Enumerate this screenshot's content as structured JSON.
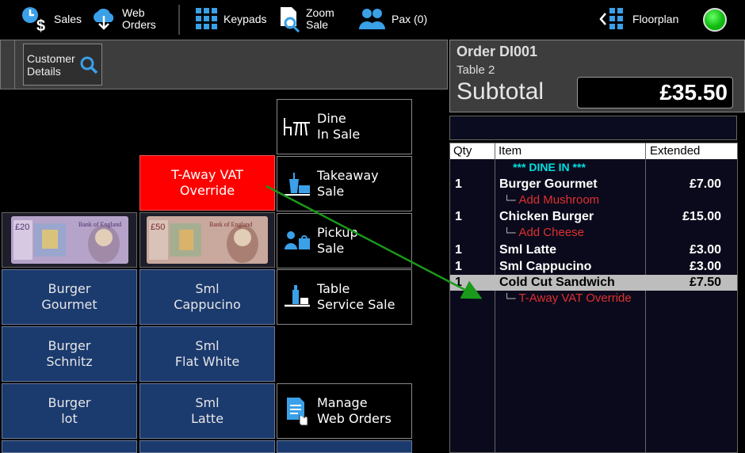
{
  "toolbar": {
    "sales_label": "Sales",
    "web_orders_label": "Web\nOrders",
    "keypads_label": "Keypads",
    "zoom_sale_label": "Zoom\nSale",
    "pax_label": "Pax (0)",
    "floorplan_label": "Floorplan",
    "status_color": "#11bb11"
  },
  "customer": {
    "details_label": "Customer\nDetails"
  },
  "tiles": {
    "override": "T-Away VAT\nOverride",
    "grid": [
      "Burger\nGourmet",
      "Sml\nCappucino",
      "Burger\nSchnitz",
      "Sml\nFlat White",
      "Burger\nlot",
      "Sml\nLatte"
    ],
    "notes": [
      "£20 note",
      "£50 note"
    ]
  },
  "sale_types": [
    {
      "label": "Dine\nIn Sale",
      "icon": "dine-in-icon"
    },
    {
      "label": "Takeaway\nSale",
      "icon": "takeaway-icon"
    },
    {
      "label": "Pickup\nSale",
      "icon": "pickup-icon"
    },
    {
      "label": "Table\nService Sale",
      "icon": "table-service-icon"
    },
    {
      "label": "Manage\nWeb Orders",
      "icon": "manage-web-orders-icon"
    }
  ],
  "order": {
    "title": "Order DI001",
    "table": "Table 2",
    "subtotal_label": "Subtotal",
    "subtotal_value": "£35.50",
    "columns": [
      "Qty",
      "Item",
      "Extended"
    ],
    "section_header": "*** DINE IN ***",
    "lines": [
      {
        "qty": "1",
        "item": "Burger Gourmet",
        "price": "£7.00",
        "modifier": "Add Mushroom"
      },
      {
        "qty": "1",
        "item": "Chicken Burger",
        "price": "£15.00",
        "modifier": "Add Cheese"
      },
      {
        "qty": "1",
        "item": "Sml Latte",
        "price": "£3.00"
      },
      {
        "qty": "1",
        "item": "Sml Cappucino",
        "price": "£3.00"
      },
      {
        "qty": "1",
        "item": "Cold Cut Sandwich",
        "price": "£7.50",
        "modifier": "T-Away VAT Override",
        "selected": true
      }
    ]
  },
  "colors": {
    "tile_blue": "#1b3a6e",
    "override_red": "#ff0000",
    "modifier_red": "#e03030",
    "section_cyan": "#00e0e0",
    "arrow_green": "#1a9a1a"
  }
}
